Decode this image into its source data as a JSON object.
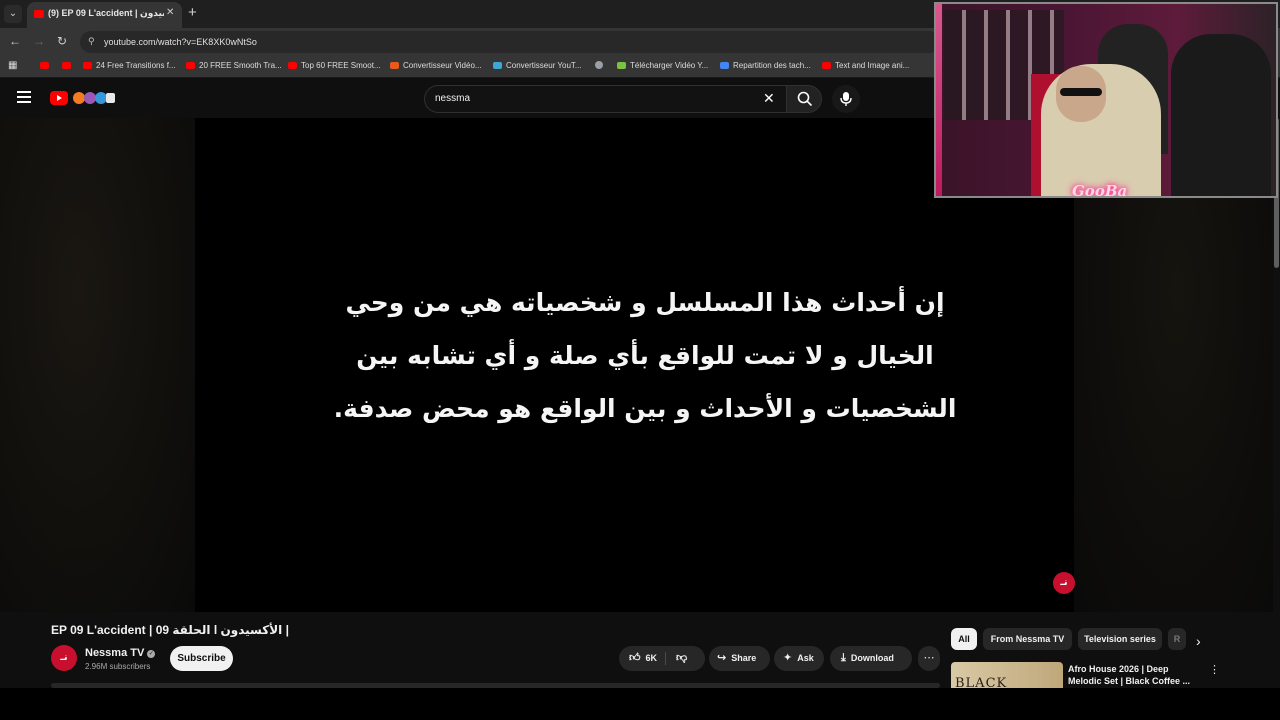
{
  "browser": {
    "tab_title": "(9) EP 09 L'accident | الأكسيدون",
    "tab_close": "✕",
    "new_tab": "+",
    "url": "youtube.com/watch?v=EK8XK0wNtSo",
    "bookmarks": [
      {
        "label": "",
        "color": "#ff0000"
      },
      {
        "label": "",
        "color": "#ff0000"
      },
      {
        "label": "24 Free Transitions f...",
        "color": "#ff0000"
      },
      {
        "label": "20 FREE Smooth Tra...",
        "color": "#ff0000"
      },
      {
        "label": "Top 60 FREE Smoot...",
        "color": "#ff0000"
      },
      {
        "label": "Convertisseur Vidéo...",
        "color": "#e85a1a"
      },
      {
        "label": "Convertisseur YouT...",
        "color": "#3fa7d6"
      },
      {
        "label": "",
        "color": "#9aa0a6"
      },
      {
        "label": "Télécharger Vidéo Y...",
        "color": "#7cc242"
      },
      {
        "label": "Repartition des tach...",
        "color": "#4285f4"
      },
      {
        "label": "Text and Image ani...",
        "color": "#ff0000"
      }
    ]
  },
  "youtube": {
    "search_query": "nessma",
    "clear_symbol": "✕"
  },
  "video": {
    "disclaimer_lines": [
      "إن أحداث هذا المسلسل و شخصياته هي من وحي",
      "الخيال و لا تمت للواقع بأي صلة و أي تشابه بين",
      "الشخصيات و الأحداث و بين الواقع هو محض صدفة."
    ],
    "watermark": "نـ"
  },
  "webcam": {
    "overlay_text": "GooBa"
  },
  "meta": {
    "title": "EP 09 L'accident | الحلقة 09 l الأكسيدون |",
    "channel_name": "Nessma TV",
    "subscribers": "2.96M subscribers",
    "avatar_text": "نـ",
    "subscribe_label": "Subscribe",
    "likes": "6K",
    "share_label": "Share",
    "ask_label": "Ask",
    "download_label": "Download",
    "more_label": "⋯"
  },
  "recommendations": {
    "chips": [
      "All",
      "From Nessma TV",
      "Television series",
      "R"
    ],
    "active_chip": "All",
    "first": {
      "title": "Afro House 2026 | Deep Melodic Set | Black Coffee ...",
      "thumb_text": "BLACK COFFEE"
    }
  },
  "colors": {
    "youtube_red": "#ff0000",
    "nessma_red": "#c8102e",
    "background": "#0f0f0f",
    "neon_pink": "#ff2a8a"
  }
}
